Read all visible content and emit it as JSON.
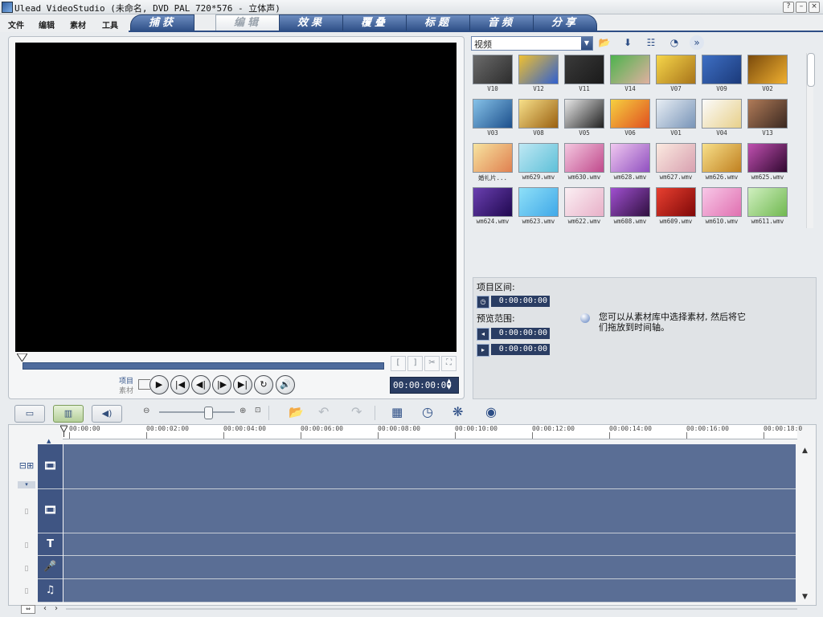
{
  "window": {
    "title": "Ulead VideoStudio (未命名, DVD PAL 720*576 - 立体声)",
    "buttons": {
      "help": "?",
      "minimize": "–",
      "close": "×"
    }
  },
  "menu": {
    "items": [
      "文件",
      "编辑",
      "素材",
      "工具"
    ]
  },
  "tabs": [
    {
      "label": "捕获",
      "active": false
    },
    {
      "label": "编辑",
      "active": true
    },
    {
      "label": "效果",
      "active": false
    },
    {
      "label": "覆叠",
      "active": false
    },
    {
      "label": "标题",
      "active": false
    },
    {
      "label": "音频",
      "active": false
    },
    {
      "label": "分享",
      "active": false
    }
  ],
  "preview": {
    "mode_labels": {
      "project": "项目",
      "clip": "素材"
    },
    "trim_in": "[",
    "trim_out": "]",
    "timecode": "00:00:00:00",
    "controls": {
      "play": "▶",
      "start": "|◀",
      "prev_frame": "◀|",
      "next_frame": "|▶",
      "end": "▶|",
      "repeat": "↻",
      "volume": "🔊"
    }
  },
  "library": {
    "category": "视频",
    "thumbnails": [
      {
        "label": "V10",
        "c1": "#6b6b6b",
        "c2": "#2c2c2c"
      },
      {
        "label": "V12",
        "c1": "#f0c030",
        "c2": "#3060d0"
      },
      {
        "label": "V11",
        "c1": "#3a3a3a",
        "c2": "#1a1a1a"
      },
      {
        "label": "V14",
        "c1": "#4db34d",
        "c2": "#e0b0a0"
      },
      {
        "label": "V07",
        "c1": "#f6d64a",
        "c2": "#a8741a"
      },
      {
        "label": "V09",
        "c1": "#3e6fc4",
        "c2": "#1b3a7a"
      },
      {
        "label": "V02",
        "c1": "#7a4a0c",
        "c2": "#f0b030"
      },
      {
        "label": "V03",
        "c1": "#86c2e8",
        "c2": "#1c4f8c"
      },
      {
        "label": "V08",
        "c1": "#f7e08a",
        "c2": "#9a6010"
      },
      {
        "label": "V05",
        "c1": "#e8e8e8",
        "c2": "#202020"
      },
      {
        "label": "V06",
        "c1": "#f6d040",
        "c2": "#e05020"
      },
      {
        "label": "V01",
        "c1": "#e8eef4",
        "c2": "#7894b8"
      },
      {
        "label": "V04",
        "c1": "#fbfbfb",
        "c2": "#e8d08a"
      },
      {
        "label": "V13",
        "c1": "#b07b58",
        "c2": "#3a2820"
      },
      {
        "label": "婚礼片...",
        "c1": "#f7e4a0",
        "c2": "#e08050"
      },
      {
        "label": "wm629.wmv",
        "c1": "#bfe8f4",
        "c2": "#5ec0d8"
      },
      {
        "label": "wm630.wmv",
        "c1": "#f4c8e0",
        "c2": "#c04a8c"
      },
      {
        "label": "wm628.wmv",
        "c1": "#f0c8f0",
        "c2": "#9050c0"
      },
      {
        "label": "wm627.wmv",
        "c1": "#fbeae0",
        "c2": "#d8a0b0"
      },
      {
        "label": "wm626.wmv",
        "c1": "#f8e08a",
        "c2": "#c08020"
      },
      {
        "label": "wm625.wmv",
        "c1": "#c050b0",
        "c2": "#300830"
      },
      {
        "label": "wm624.wmv",
        "c1": "#6a40b0",
        "c2": "#200850"
      },
      {
        "label": "wm623.wmv",
        "c1": "#8ee0f8",
        "c2": "#40a8e8"
      },
      {
        "label": "wm622.wmv",
        "c1": "#fbf0f4",
        "c2": "#e8b0c8"
      },
      {
        "label": "wm608.wmv",
        "c1": "#a050d0",
        "c2": "#301040"
      },
      {
        "label": "wm609.wmv",
        "c1": "#e84030",
        "c2": "#800808"
      },
      {
        "label": "wm610.wmv",
        "c1": "#f8c8e8",
        "c2": "#e070b0"
      },
      {
        "label": "wm611.wmv",
        "c1": "#d0f0c0",
        "c2": "#70b850"
      }
    ]
  },
  "info": {
    "project_duration_label": "项目区间:",
    "project_duration": "0:00:00:00",
    "preview_range_label": "预览范围:",
    "preview_start": "0:00:00:00",
    "preview_end": "0:00:00:00",
    "hint": "您可以从素材库中选择素材, 然后将它们拖放到时间轴。"
  },
  "timeline": {
    "ruler": [
      "00:00:00",
      "00:00:02:00",
      "00:00:04:00",
      "00:00:06:00",
      "00:00:08:00",
      "00:00:10:00",
      "00:00:12:00",
      "00:00:14:00",
      "00:00:16:00",
      "00:00:18:0"
    ],
    "tracks": [
      {
        "name": "video-track",
        "icon": "🎞"
      },
      {
        "name": "overlay-track",
        "icon": "🎞"
      },
      {
        "name": "title-track",
        "icon": "T"
      },
      {
        "name": "voice-track",
        "icon": "🎤"
      },
      {
        "name": "music-track",
        "icon": "♫"
      }
    ]
  },
  "colors": {
    "accent": "#2d4e86",
    "track": "#5a6e95"
  }
}
